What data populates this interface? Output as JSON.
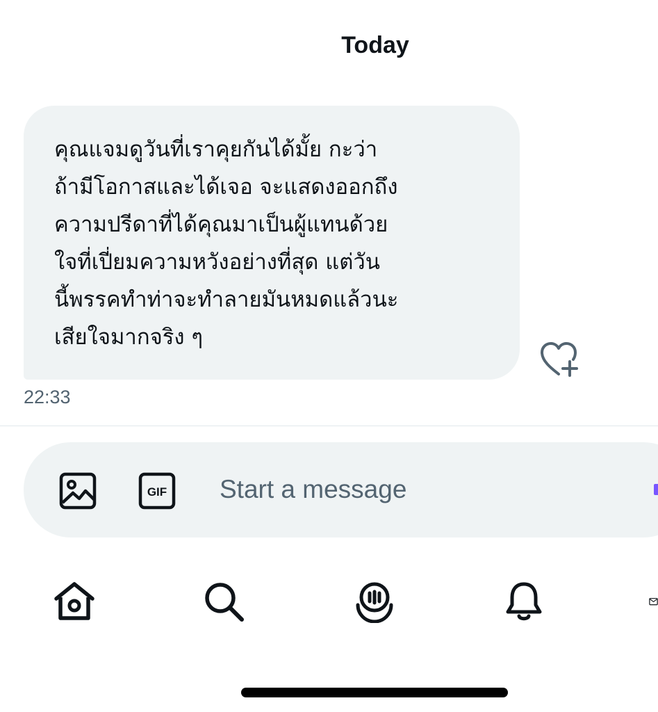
{
  "header": {
    "date_label": "Today"
  },
  "message": {
    "lines": [
      "คุณแจมดูวันที่เราคุยกันได้มั้ย กะว่า",
      "ถ้ามีโอกาสและได้เจอ จะแสดงออกถึง",
      "ความปรีดาที่ได้คุณมาเป็นผู้แทนด้วย",
      "ใจที่เปี่ยมความหวังอย่างที่สุด แต่วัน",
      "นี้พรรคทำท่าจะทำลายมันหมดแล้วนะ",
      "เสียใจมากจริง ๆ"
    ],
    "timestamp": "22:33",
    "react_icon": "heart-plus-icon"
  },
  "composer": {
    "placeholder": "Start a message",
    "gif_label": "GIF",
    "icons": [
      "image-icon",
      "gif-icon"
    ]
  },
  "tabbar": {
    "items": [
      {
        "name": "home",
        "icon": "home-icon"
      },
      {
        "name": "search",
        "icon": "search-icon"
      },
      {
        "name": "spaces",
        "icon": "spaces-icon"
      },
      {
        "name": "notifications",
        "icon": "bell-icon"
      },
      {
        "name": "messages",
        "icon": "mail-icon"
      }
    ]
  },
  "colors": {
    "text_primary": "#0f1419",
    "text_secondary": "#536471",
    "bubble_bg": "#eff3f4",
    "accent": "#7856ff"
  }
}
